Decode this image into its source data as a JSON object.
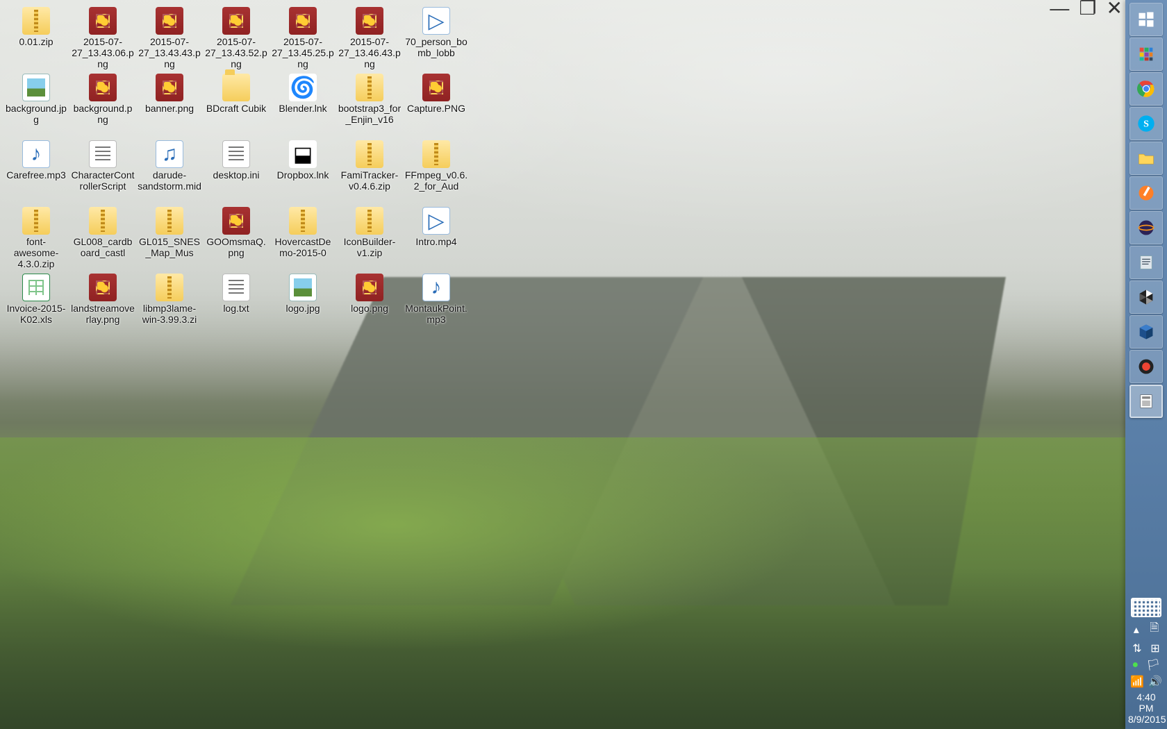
{
  "window_controls": {
    "minimize": "—",
    "maximize": "❐",
    "close": "✕"
  },
  "desktop_icons": [
    {
      "label": "0.01.zip",
      "type": "zip"
    },
    {
      "label": "2015-07-27_13.43.06.png",
      "type": "png"
    },
    {
      "label": "2015-07-27_13.43.43.png",
      "type": "png"
    },
    {
      "label": "2015-07-27_13.43.52.png",
      "type": "png"
    },
    {
      "label": "2015-07-27_13.45.25.png",
      "type": "png"
    },
    {
      "label": "2015-07-27_13.46.43.png",
      "type": "png"
    },
    {
      "label": "70_person_bomb_lobb",
      "type": "mp4"
    },
    {
      "label": "background.jpg",
      "type": "jpg"
    },
    {
      "label": "background.png",
      "type": "png"
    },
    {
      "label": "banner.png",
      "type": "png"
    },
    {
      "label": "BDcraft Cubik",
      "type": "folder"
    },
    {
      "label": "Blender.lnk",
      "type": "blender"
    },
    {
      "label": "bootstrap3_for_Enjin_v16",
      "type": "zip"
    },
    {
      "label": "Capture.PNG",
      "type": "png"
    },
    {
      "label": "Carefree.mp3",
      "type": "mp3"
    },
    {
      "label": "CharacterControllerScript",
      "type": "txt"
    },
    {
      "label": "darude-sandstorm.mid",
      "type": "mid"
    },
    {
      "label": "desktop.ini",
      "type": "ini"
    },
    {
      "label": "Dropbox.lnk",
      "type": "dropbox"
    },
    {
      "label": "FamiTracker-v0.4.6.zip",
      "type": "zip"
    },
    {
      "label": "FFmpeg_v0.6.2_for_Aud",
      "type": "zip"
    },
    {
      "label": "font-awesome-4.3.0.zip",
      "type": "zip"
    },
    {
      "label": "GL008_cardboard_castl",
      "type": "zip"
    },
    {
      "label": "GL015_SNES_Map_Mus",
      "type": "zip"
    },
    {
      "label": "GOOmsmaQ.png",
      "type": "png"
    },
    {
      "label": "HovercastDemo-2015-0",
      "type": "zip"
    },
    {
      "label": "IconBuilder-v1.zip",
      "type": "zip"
    },
    {
      "label": "Intro.mp4",
      "type": "mp4"
    },
    {
      "label": "Invoice-2015-K02.xls",
      "type": "xls"
    },
    {
      "label": "landstreamoverlay.png",
      "type": "png"
    },
    {
      "label": "libmp3lame-win-3.99.3.zi",
      "type": "zip"
    },
    {
      "label": "log.txt",
      "type": "txt"
    },
    {
      "label": "logo.jpg",
      "type": "jpg"
    },
    {
      "label": "logo.png",
      "type": "png"
    },
    {
      "label": "MontaukPoint.mp3",
      "type": "mp3"
    }
  ],
  "taskbar": {
    "apps": [
      {
        "name": "start",
        "icon": "windows"
      },
      {
        "name": "apps",
        "icon": "grid"
      },
      {
        "name": "chrome",
        "icon": "chrome"
      },
      {
        "name": "skype",
        "icon": "skype"
      },
      {
        "name": "file-explorer",
        "icon": "folder"
      },
      {
        "name": "snipping",
        "icon": "pen"
      },
      {
        "name": "eclipse",
        "icon": "eclipse"
      },
      {
        "name": "notepadpp",
        "icon": "note"
      },
      {
        "name": "unity",
        "icon": "unity"
      },
      {
        "name": "virtualbox",
        "icon": "vbox"
      },
      {
        "name": "recorder",
        "icon": "record"
      },
      {
        "name": "scan",
        "icon": "scan",
        "active": true
      }
    ],
    "tray": {
      "keyboard": true,
      "row1": [
        "▴",
        "🗎"
      ],
      "row2": [
        "⇅",
        "⊞"
      ],
      "row3": [
        "●",
        "🏳"
      ],
      "row4": [
        "📶",
        "🔊"
      ]
    },
    "clock": {
      "time": "4:40 PM",
      "date": "8/9/2015"
    }
  }
}
